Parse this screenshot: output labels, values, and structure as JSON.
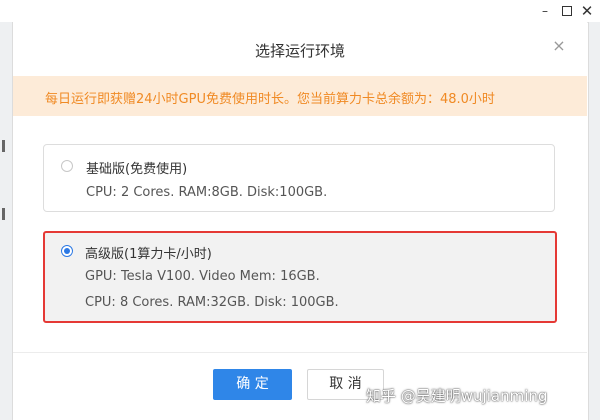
{
  "window": {
    "minimize_glyph": "–",
    "close_glyph": "✕"
  },
  "dialog": {
    "title": "选择运行环境",
    "close_glyph": "×",
    "notice": "每日运行即获赠24小时GPU免费使用时长。您当前算力卡总余额为：48.0小时",
    "options": [
      {
        "title": "基础版(免费使用)",
        "lines": [
          "CPU: 2 Cores. RAM:8GB. Disk:100GB."
        ],
        "selected": false
      },
      {
        "title": "高级版(1算力卡/小时)",
        "lines": [
          "GPU: Tesla V100. Video Mem: 16GB.",
          "CPU: 8 Cores. RAM:32GB. Disk: 100GB."
        ],
        "selected": true
      }
    ],
    "confirm_label": "确 定",
    "cancel_label": "取 消"
  },
  "watermark": "知乎 @吴建明wujianming",
  "colors": {
    "primary": "#2f86e8",
    "notice_bg": "#fdebd8",
    "notice_text": "#f08a24",
    "highlight_border": "#e53935"
  }
}
